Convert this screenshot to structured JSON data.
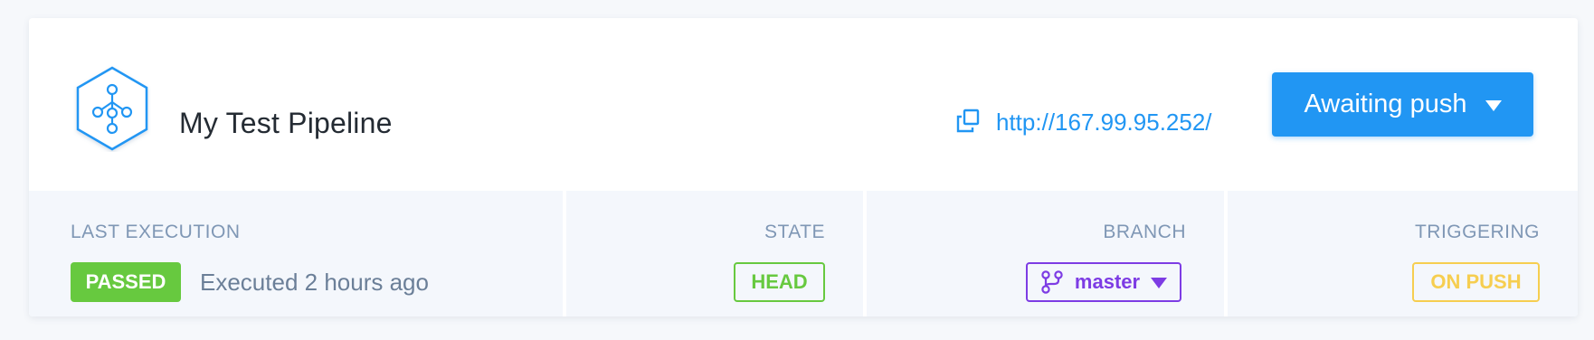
{
  "pipeline": {
    "name": "My Test Pipeline",
    "url": "http://167.99.95.252/",
    "logo_icon": "pipeline-hexagon-icon",
    "copy_icon": "copy-icon"
  },
  "action_button": {
    "label": "Awaiting push",
    "icon": "caret-down-icon",
    "color": "#2196f3"
  },
  "last_execution": {
    "label": "LAST EXECUTION",
    "status": "PASSED",
    "status_color": "#67c93f",
    "text": "Executed 2 hours ago"
  },
  "state": {
    "label": "STATE",
    "value": "HEAD",
    "color": "#67c93f"
  },
  "branch": {
    "label": "BRANCH",
    "value": "master",
    "icon": "git-branch-icon",
    "color": "#7d3ce4"
  },
  "triggering": {
    "label": "TRIGGERING",
    "value": "ON PUSH",
    "color": "#f6ce50"
  }
}
